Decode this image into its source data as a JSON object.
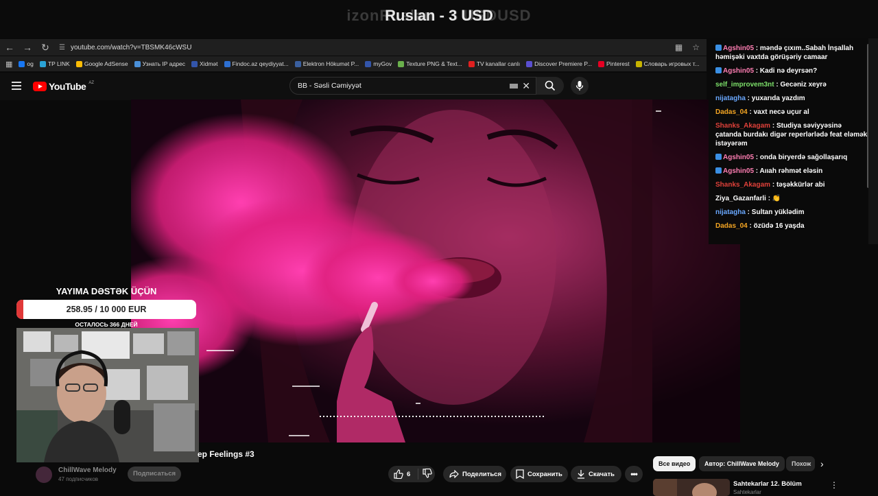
{
  "overlay": {
    "ghost_text": "izonRuslan - 3 USDUSD",
    "title": "Ruslan - 3 USD"
  },
  "browser": {
    "url": "youtube.com/watch?v=TBSMK46cWSU",
    "bookmarks": [
      {
        "label": "og",
        "color": "#1877f2"
      },
      {
        "label": "TP LINK",
        "color": "#2ba3d6"
      },
      {
        "label": "Google AdSense",
        "color": "#fbbc05"
      },
      {
        "label": "Узнать IP адрес",
        "color": "#4a90d9"
      },
      {
        "label": "Xidmət",
        "color": "#3355aa"
      },
      {
        "label": "Findoc.az qeydiyyat...",
        "color": "#2d6fd1"
      },
      {
        "label": "Elektron Hökumət P...",
        "color": "#3a5f9f"
      },
      {
        "label": "myGov",
        "color": "#3355aa"
      },
      {
        "label": "Texture PNG & Text...",
        "color": "#6ab04c"
      },
      {
        "label": "TV kanallar canlı",
        "color": "#e02020"
      },
      {
        "label": "Discover Premiere P...",
        "color": "#5a4fcf"
      },
      {
        "label": "Pinterest",
        "color": "#e60023"
      },
      {
        "label": "Словарь игровых т...",
        "color": "#c8b400"
      }
    ]
  },
  "youtube": {
    "logo_text": "YouTube",
    "region": "AZ",
    "search_value": "BB - Səsli Cəmiyyət"
  },
  "chat": {
    "messages": [
      {
        "user": "Agshin05",
        "text": "məndə çıxım..Sabah İnşallah həmişəki vaxtda görüşəriy camaar",
        "color": "#ff7eb3",
        "badge": true
      },
      {
        "user": "Agshin05",
        "text": "Kadi nə deyrsən?",
        "color": "#ff7eb3",
        "badge": true
      },
      {
        "user": "self_improvem3nt",
        "text": "Gecəniz xeyrə",
        "color": "#7de06a",
        "badge": false
      },
      {
        "user": "nijatagha",
        "text": "yuxarıda yazdım",
        "color": "#6aa8ff",
        "badge": false
      },
      {
        "user": "Dadas_04",
        "text": "vaxt necə uçur al",
        "color": "#f5a623",
        "badge": false
      },
      {
        "user": "Shanks_Akagam",
        "text": "Studiya səviyyəsinə çatanda burdakı digər reperlərlədə feat eləmək istəyərəm",
        "color": "#e0413a",
        "badge": false
      },
      {
        "user": "Agshin05",
        "text": "onda biryerdə sağollaşarıq",
        "color": "#ff7eb3",
        "badge": true
      },
      {
        "user": "Agshin05",
        "text": "Aııah rəhmət eləsin",
        "color": "#ff7eb3",
        "badge": true
      },
      {
        "user": "Shanks_Akagam",
        "text": "təşəkkürlər abi",
        "color": "#e0413a",
        "badge": false
      },
      {
        "user": "Ziya_Gazanfarli",
        "text": "👏",
        "color": "#ffffff",
        "badge": false
      },
      {
        "user": "nijatagha",
        "text": "Sultan yüklədim",
        "color": "#6aa8ff",
        "badge": false
      },
      {
        "user": "Dadas_04",
        "text": "özüdə 16 yaşda",
        "color": "#f5a623",
        "badge": false
      }
    ]
  },
  "donation": {
    "title": "YAYIMA DƏSTƏK ÜÇÜN",
    "amount": "258.95 / 10 000 EUR",
    "progress": 0.026,
    "days_left": "ОСТАЛОСЬ 366 ДНЕЙ"
  },
  "video": {
    "title": "ep Feelings #3",
    "channel": "ChillWave Melody",
    "subscribers": "47 подписчиков",
    "subscribe_label": "Подписаться",
    "likes": "6",
    "share_label": "Поделиться",
    "save_label": "Сохранить",
    "download_label": "Скачать"
  },
  "chips": {
    "all": "Все видео",
    "author": "Автор: ChillWave Melody",
    "similar": "Похож"
  },
  "recommended": {
    "title": "Sahtekarlar 12. Bölüm",
    "channel": "Sahtekarlar"
  }
}
